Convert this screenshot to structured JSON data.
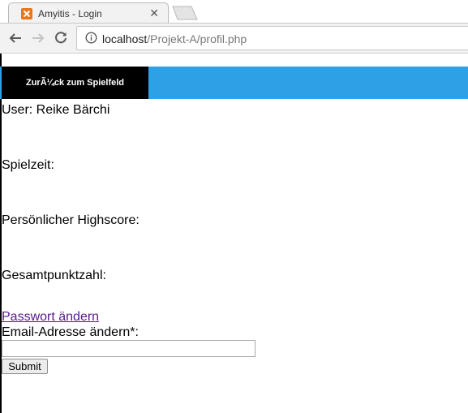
{
  "browser": {
    "tab_title": "Amyitis - Login",
    "url_host": "localhost",
    "url_path": "/Projekt-A/profil.php"
  },
  "navbar": {
    "back_label": "ZurÃ¼ck zum Spielfeld",
    "back_color": "#000000",
    "bar_color": "#2da0e6"
  },
  "profile": {
    "user_line": "User: Reike Bärchi",
    "playtime_label": "Spielzeit:",
    "highscore_label": "Persönlicher Highscore:",
    "total_points_label": "Gesamtpunktzahl:"
  },
  "links": {
    "change_password": "Passwort ändern"
  },
  "email_form": {
    "label": "Email-Adresse ändern*:",
    "value": "",
    "submit_label": "Submit"
  }
}
